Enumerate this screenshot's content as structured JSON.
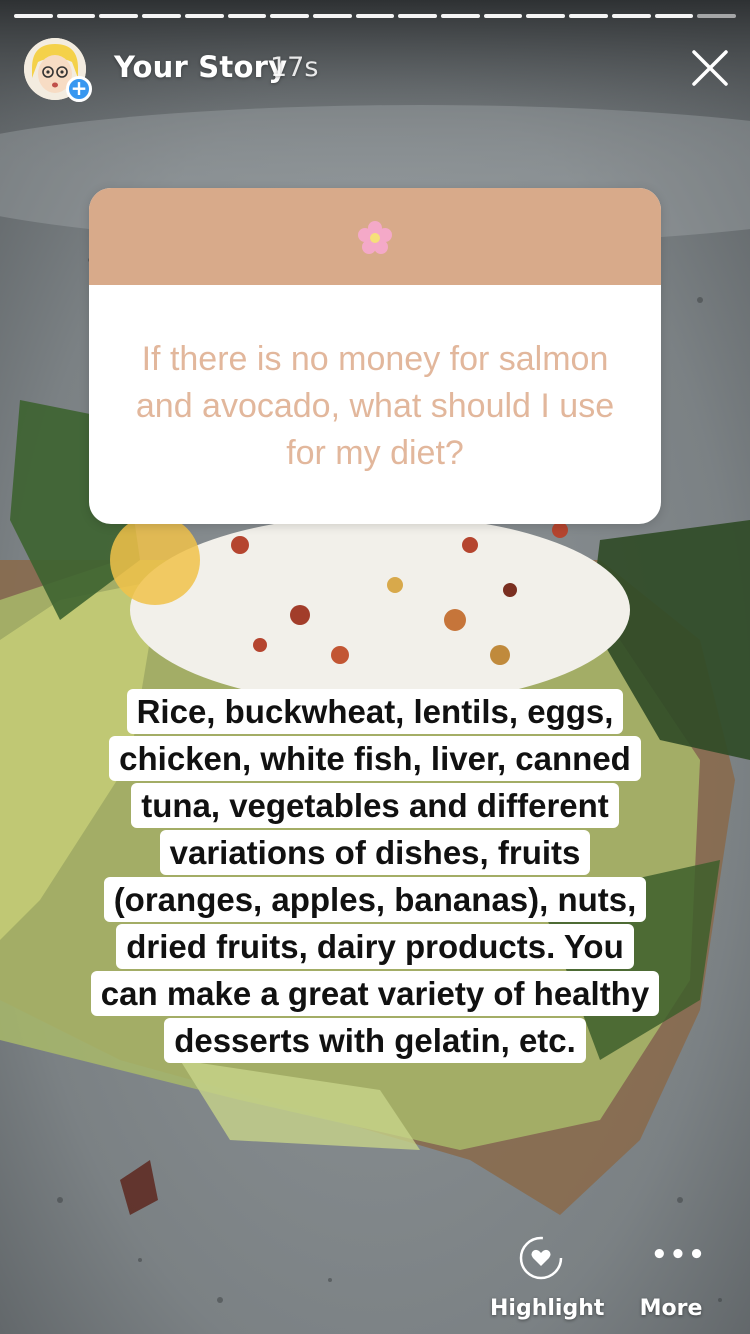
{
  "header": {
    "name": "Your Story",
    "time": "17s",
    "progress_segments": 17,
    "progress_current": 17
  },
  "question": {
    "emoji": "flower-icon",
    "text": "If there is no money for salmon and avocado, what should I use for my diet?",
    "header_color": "#d8aa8a",
    "text_color": "#e2b79c"
  },
  "answer": {
    "lines": [
      "Rice, buckwheat, lentils, eggs,",
      "chicken, white fish, liver, canned",
      "tuna, vegetables and different",
      "variations of dishes, fruits",
      "(oranges, apples, bananas), nuts,",
      "dried fruits, dairy products.  You",
      "can make a great variety of healthy",
      "desserts with gelatin, etc."
    ]
  },
  "footer": {
    "highlight_label": "Highlight",
    "more_label": "More"
  }
}
